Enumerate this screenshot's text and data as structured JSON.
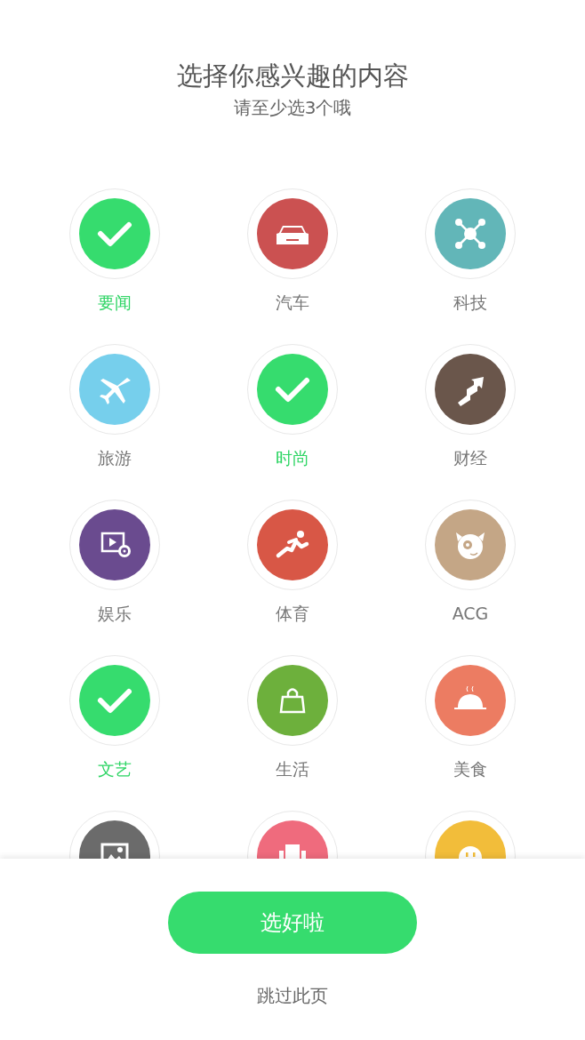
{
  "header": {
    "title": "选择你感兴趣的内容",
    "subtitle": "请至少选3个哦"
  },
  "topics": [
    {
      "label": "要闻",
      "selected": true,
      "color": "#36dc6e"
    },
    {
      "label": "汽车",
      "selected": false,
      "kind": "car",
      "color": "#cb5151"
    },
    {
      "label": "科技",
      "selected": false,
      "kind": "network",
      "color": "#62b6b8"
    },
    {
      "label": "旅游",
      "selected": false,
      "kind": "plane",
      "color": "#76cfec"
    },
    {
      "label": "时尚",
      "selected": true,
      "color": "#36dc6e"
    },
    {
      "label": "财经",
      "selected": false,
      "kind": "stairs",
      "color": "#6a564b"
    },
    {
      "label": "娱乐",
      "selected": false,
      "kind": "video",
      "color": "#6a4b8f"
    },
    {
      "label": "体育",
      "selected": false,
      "kind": "runner",
      "color": "#d85746"
    },
    {
      "label": "ACG",
      "selected": false,
      "kind": "monster",
      "color": "#c4a686"
    },
    {
      "label": "文艺",
      "selected": true,
      "color": "#36dc6e"
    },
    {
      "label": "生活",
      "selected": false,
      "kind": "bag",
      "color": "#6db03c"
    },
    {
      "label": "美食",
      "selected": false,
      "kind": "cloche",
      "color": "#ec7c62"
    },
    {
      "selected": false,
      "kind": "photo",
      "color": "#6b6b6b"
    },
    {
      "selected": false,
      "kind": "chair",
      "color": "#ef6b7d"
    },
    {
      "selected": false,
      "kind": "face",
      "color": "#f2bd3a"
    }
  ],
  "footer": {
    "confirm": "选好啦",
    "skip": "跳过此页"
  }
}
